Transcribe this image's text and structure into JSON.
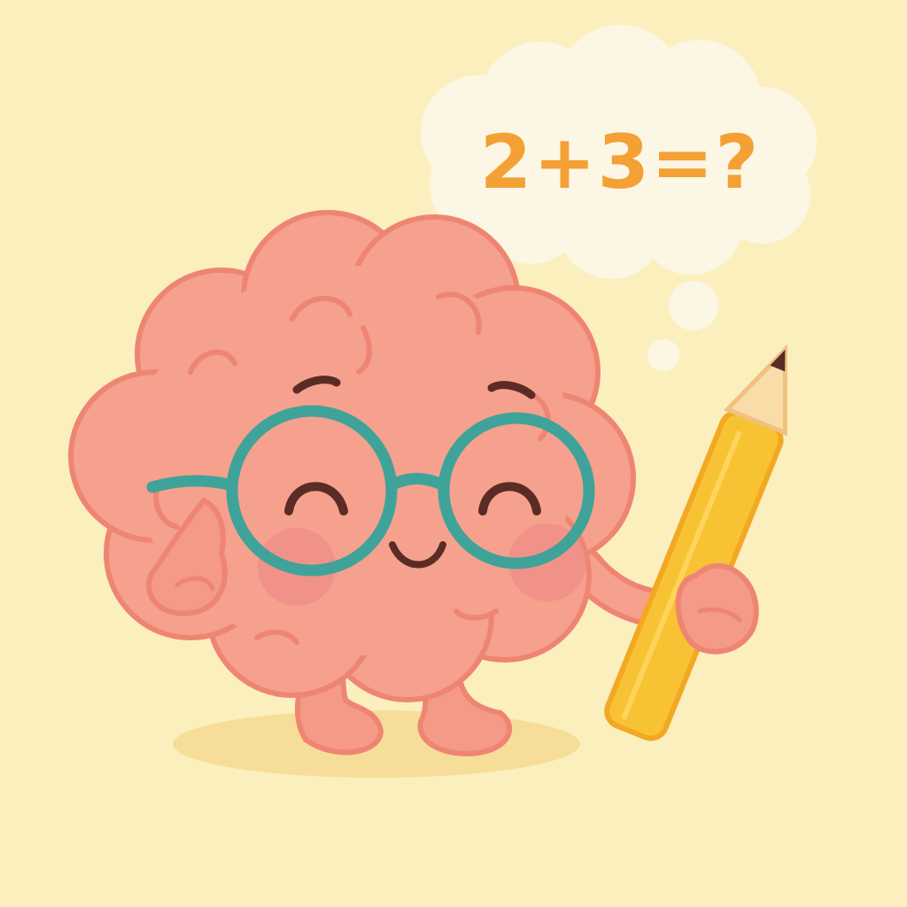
{
  "thought_bubble": {
    "equation": "2+3=?"
  },
  "character": {
    "subject": "brain-mascot",
    "accessories": [
      "glasses-icon",
      "pencil-icon"
    ]
  },
  "colors": {
    "background": "#FCEFBE",
    "brain": "#F6A08E",
    "brain_outline": "#EE8573",
    "glasses": "#3FA39A",
    "pencil": "#F8C235",
    "equation": "#F3A035",
    "bubble": "#FCF6E4"
  }
}
